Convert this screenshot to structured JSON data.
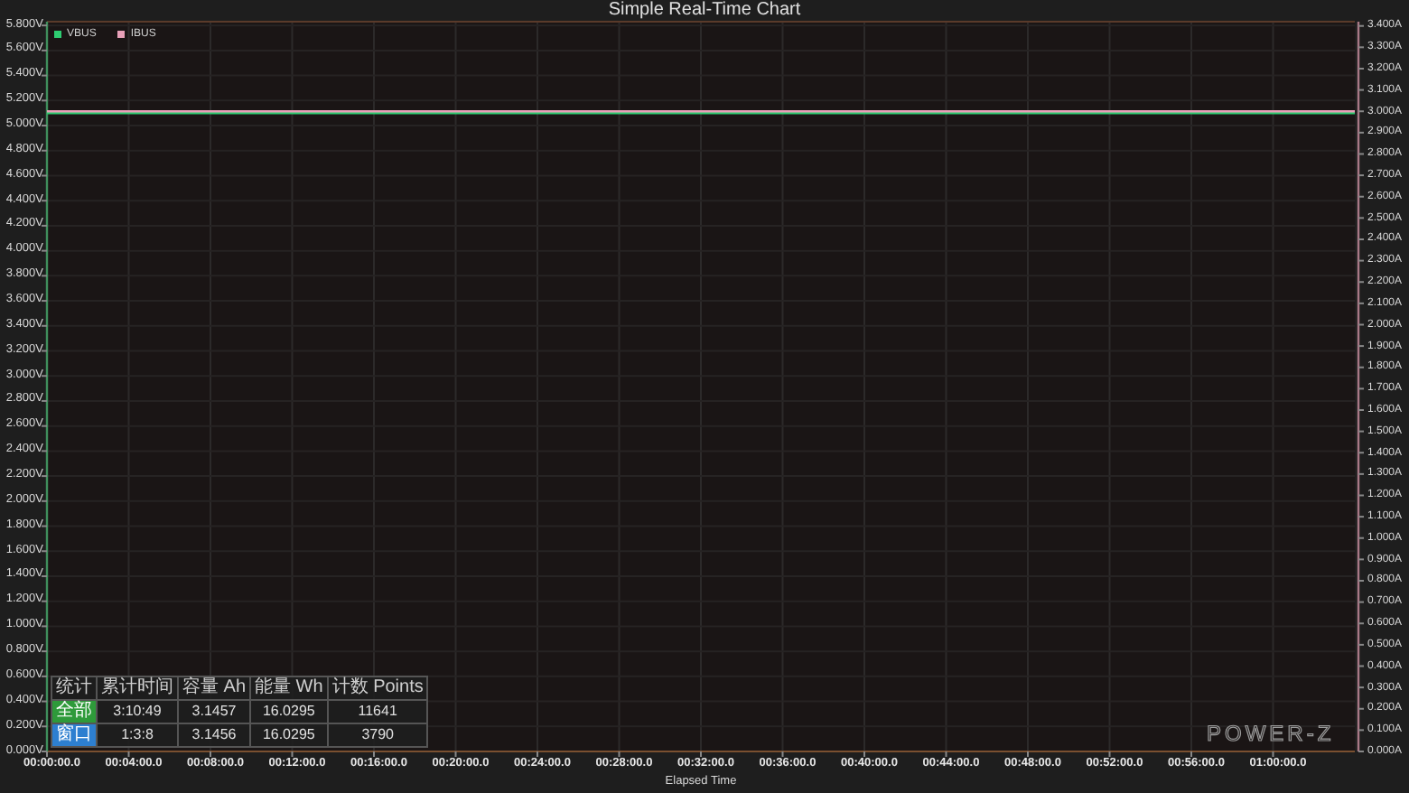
{
  "title": "Simple Real-Time Chart",
  "chart_data": {
    "type": "line",
    "xlabel": "Elapsed Time",
    "grid": true,
    "legend": "top-left",
    "ylim": [
      0,
      5.83
    ],
    "y2lim": [
      0,
      3.42
    ],
    "categories": [
      "00:00:00.0",
      "00:04:00.0",
      "00:08:00.0",
      "00:12:00.0",
      "00:16:00.0",
      "00:20:00.0",
      "00:24:00.0",
      "00:28:00.0",
      "00:32:00.0",
      "00:36:00.0",
      "00:40:00.0",
      "00:44:00.0",
      "00:48:00.0",
      "00:52:00.0",
      "00:56:00.0",
      "01:00:00.0",
      null
    ],
    "yticks": [
      {
        "value": 0,
        "label": "0.000V"
      },
      {
        "value": 0.2,
        "label": "0.200V"
      },
      {
        "value": 0.4,
        "label": "0.400V"
      },
      {
        "value": 0.6,
        "label": "0.600V"
      },
      {
        "value": 0.8,
        "label": "0.800V"
      },
      {
        "value": 1.0,
        "label": "1.000V"
      },
      {
        "value": 1.2,
        "label": "1.200V"
      },
      {
        "value": 1.4,
        "label": "1.400V"
      },
      {
        "value": 1.6,
        "label": "1.600V"
      },
      {
        "value": 1.8,
        "label": "1.800V"
      },
      {
        "value": 2.0,
        "label": "2.000V"
      },
      {
        "value": 2.2,
        "label": "2.200V"
      },
      {
        "value": 2.4,
        "label": "2.400V"
      },
      {
        "value": 2.6,
        "label": "2.600V"
      },
      {
        "value": 2.8,
        "label": "2.800V"
      },
      {
        "value": 3.0,
        "label": "3.000V"
      },
      {
        "value": 3.2,
        "label": "3.200V"
      },
      {
        "value": 3.4,
        "label": "3.400V"
      },
      {
        "value": 3.6,
        "label": "3.600V"
      },
      {
        "value": 3.8,
        "label": "3.800V"
      },
      {
        "value": 4.0,
        "label": "4.000V"
      },
      {
        "value": 4.2,
        "label": "4.200V"
      },
      {
        "value": 4.4,
        "label": "4.400V"
      },
      {
        "value": 4.6,
        "label": "4.600V"
      },
      {
        "value": 4.8,
        "label": "4.800V"
      },
      {
        "value": 5.0,
        "label": "5.000V"
      },
      {
        "value": 5.2,
        "label": "5.200V"
      },
      {
        "value": 5.4,
        "label": "5.400V"
      },
      {
        "value": 5.6,
        "label": "5.600V"
      },
      {
        "value": 5.8,
        "label": "5.800V"
      }
    ],
    "y2ticks": [
      {
        "value": 0,
        "label": "0.000A"
      },
      {
        "value": 0.1,
        "label": "0.100A"
      },
      {
        "value": 0.2,
        "label": "0.200A"
      },
      {
        "value": 0.3,
        "label": "0.300A"
      },
      {
        "value": 0.4,
        "label": "0.400A"
      },
      {
        "value": 0.5,
        "label": "0.500A"
      },
      {
        "value": 0.6,
        "label": "0.600A"
      },
      {
        "value": 0.7,
        "label": "0.700A"
      },
      {
        "value": 0.8,
        "label": "0.800A"
      },
      {
        "value": 0.9,
        "label": "0.900A"
      },
      {
        "value": 1.0,
        "label": "1.000A"
      },
      {
        "value": 1.1,
        "label": "1.100A"
      },
      {
        "value": 1.2,
        "label": "1.200A"
      },
      {
        "value": 1.3,
        "label": "1.300A"
      },
      {
        "value": 1.4,
        "label": "1.400A"
      },
      {
        "value": 1.5,
        "label": "1.500A"
      },
      {
        "value": 1.6,
        "label": "1.600A"
      },
      {
        "value": 1.7,
        "label": "1.700A"
      },
      {
        "value": 1.8,
        "label": "1.800A"
      },
      {
        "value": 1.9,
        "label": "1.900A"
      },
      {
        "value": 2.0,
        "label": "2.000A"
      },
      {
        "value": 2.1,
        "label": "2.100A"
      },
      {
        "value": 2.2,
        "label": "2.200A"
      },
      {
        "value": 2.3,
        "label": "2.300A"
      },
      {
        "value": 2.4,
        "label": "2.400A"
      },
      {
        "value": 2.5,
        "label": "2.500A"
      },
      {
        "value": 2.6,
        "label": "2.600A"
      },
      {
        "value": 2.7,
        "label": "2.700A"
      },
      {
        "value": 2.8,
        "label": "2.800A"
      },
      {
        "value": 2.9,
        "label": "2.900A"
      },
      {
        "value": 3.0,
        "label": "3.000A"
      },
      {
        "value": 3.1,
        "label": "3.100A"
      },
      {
        "value": 3.2,
        "label": "3.200A"
      },
      {
        "value": 3.3,
        "label": "3.300A"
      },
      {
        "value": 3.4,
        "label": "3.400A"
      }
    ],
    "series": [
      {
        "name": "VBUS",
        "color": "#2ecc71",
        "values": [
          5.1,
          5.1,
          5.1,
          5.1,
          5.1,
          5.1,
          5.1,
          5.1,
          5.1,
          5.1,
          5.1,
          5.1,
          5.1,
          5.1,
          5.1,
          5.1,
          5.1
        ]
      },
      {
        "name": "IBUS",
        "color": "#e8a0b8",
        "axis": "y2",
        "values": [
          3.0,
          3.0,
          3.0,
          3.0,
          3.0,
          3.0,
          3.0,
          3.0,
          3.0,
          3.0,
          3.0,
          3.0,
          3.0,
          3.0,
          3.0,
          3.0,
          3.0
        ]
      }
    ]
  },
  "stats_table": {
    "columns": [
      "统计",
      "累计时间",
      "容量 Ah",
      "能量 Wh",
      "计数 Points"
    ],
    "rows": [
      {
        "color": "#2e9a3a",
        "cells": [
          "全部",
          "3:10:49",
          "3.1457",
          "16.0295",
          "11641"
        ]
      },
      {
        "color": "#2d7fd0",
        "cells": [
          "窗口",
          "1:3:8",
          "3.1456",
          "16.0295",
          "3790"
        ]
      }
    ]
  },
  "logo": "POWER-Z"
}
